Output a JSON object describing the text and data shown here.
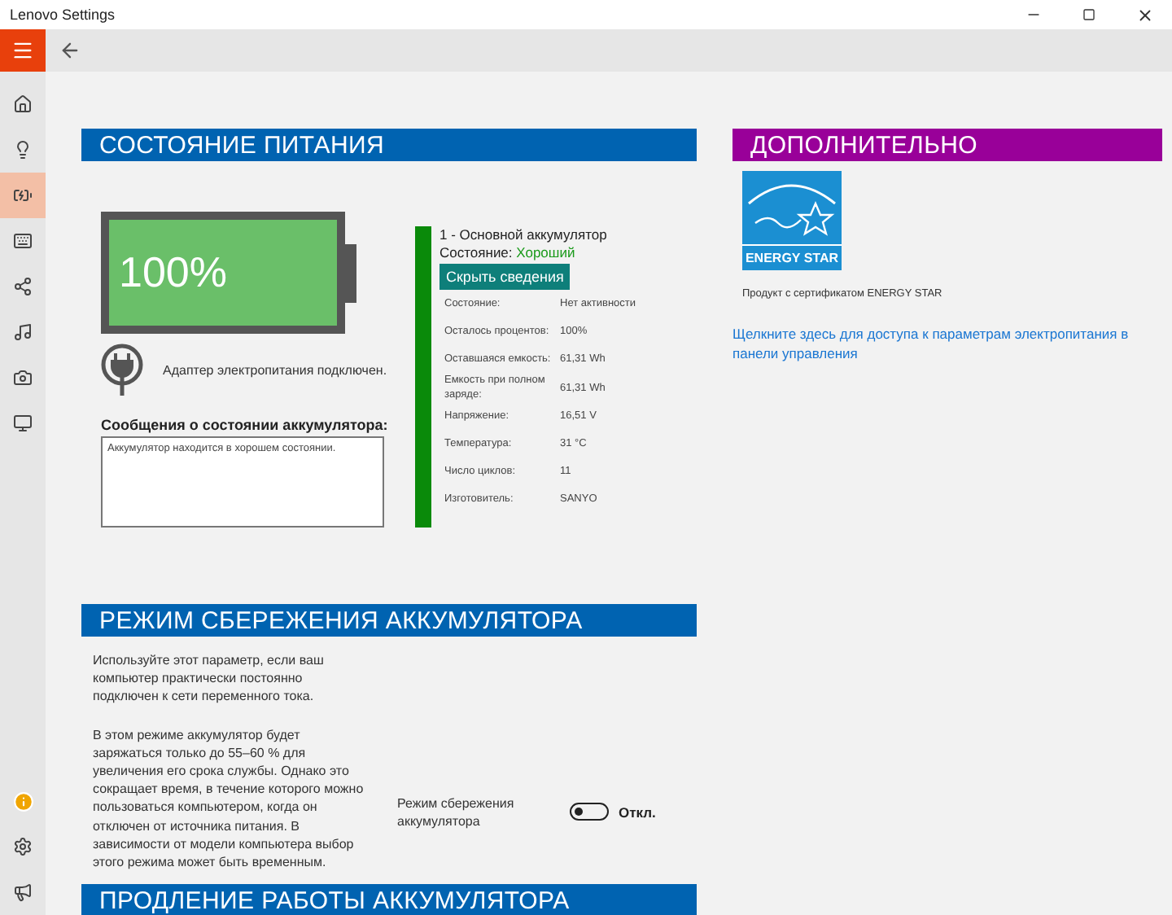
{
  "window": {
    "title": "Lenovo Settings"
  },
  "sidebar": {
    "items": [
      {
        "selected": false
      },
      {
        "selected": false
      },
      {
        "selected": true
      },
      {
        "selected": false
      },
      {
        "selected": false
      },
      {
        "selected": false
      },
      {
        "selected": false
      },
      {
        "selected": false
      }
    ]
  },
  "power_status": {
    "title": "СОСТОЯНИЕ ПИТАНИЯ",
    "battery": {
      "level": 1,
      "reading": "100%"
    },
    "adapter_text": "Адаптер электропитания  подключен.",
    "messages_label": "Сообщения о состоянии аккумулятора:",
    "messages_text": "Аккумулятор находится в хорошем состоянии.",
    "details": {
      "name": "1 - Основной аккумулятор",
      "status_label": "Состояние:",
      "status_value": "Хороший",
      "hide_button": "Скрыть сведения",
      "rows": [
        {
          "label": "Состояние:",
          "value": "Нет активности"
        },
        {
          "label": "Осталось процентов:",
          "value": "100%"
        },
        {
          "label": "Оставшаяся емкость:",
          "value": "61,31 Wh"
        },
        {
          "label": "Емкость при полном заряде:",
          "value": "61,31 Wh"
        },
        {
          "label": "Напряжение:",
          "value": "16,51 V"
        },
        {
          "label": "Температура:",
          "value": "31 °C"
        },
        {
          "label": "Число циклов:",
          "value": "11"
        },
        {
          "label": "Изготовитель:",
          "value": "SANYO"
        }
      ]
    }
  },
  "additional": {
    "title": "ДОПОЛНИТЕЛЬНО",
    "logo_caption": "ENERGY STAR",
    "certified_text": "Продукт с сертификатом ENERGY STAR",
    "link": "Щелкните здесь для доступа к параметрам электропитания в панели управления"
  },
  "conservation": {
    "title": "РЕЖИМ СБЕРЕЖЕНИЯ АККУМУЛЯТОРА",
    "paragraphs": [
      "Используйте этот параметр, если ваш компьютер практически постоянно подключен к сети переменного тока.",
      "В этом режиме аккумулятор будет заряжаться только до 55–60 % для увеличения его срока службы. Однако это сокращает время, в течение которого можно пользоваться компьютером, когда он отключен от источника питания. В зависимости от модели компьютера выбор этого режима может быть временным."
    ],
    "toggle": {
      "label": "Режим сбережения аккумулятора",
      "on": false,
      "state_text": "Откл."
    }
  },
  "extension": {
    "title": "ПРОДЛЕНИЕ РАБОТЫ АККУМУЛЯТОРА"
  }
}
